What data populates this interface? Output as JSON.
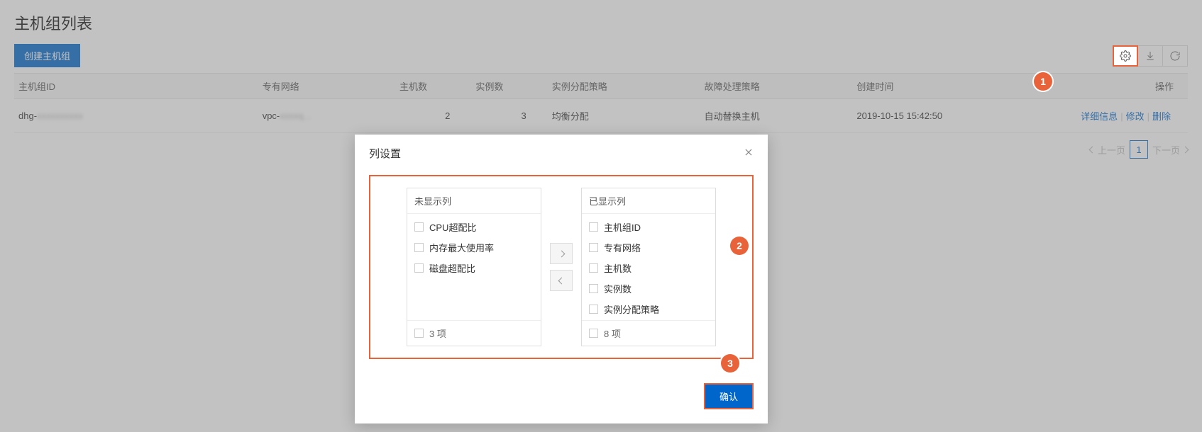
{
  "page_title": "主机组列表",
  "toolbar": {
    "create_button": "创建主机组"
  },
  "icons": {
    "settings": "gear-icon",
    "download": "download-icon",
    "refresh": "refresh-icon"
  },
  "columns": [
    "主机组ID",
    "专有网络",
    "主机数",
    "实例数",
    "实例分配策略",
    "故障处理策略",
    "创建时间",
    "操作"
  ],
  "row": {
    "host_group_id_prefix": "dhg-",
    "host_group_id_masked": "xxxxxxxxxx",
    "vpc_prefix": "vpc-",
    "vpc_masked": "xxxxq...",
    "host_count": "2",
    "instance_count": "3",
    "alloc_policy": "均衡分配",
    "fault_policy": "自动替换主机",
    "created_at": "2019-10-15 15:42:50",
    "actions": {
      "detail": "详细信息",
      "edit": "修改",
      "delete": "删除"
    }
  },
  "pagination": {
    "prev": "上一页",
    "page": "1",
    "next": "下一页"
  },
  "modal": {
    "title": "列设置",
    "left_header": "未显示列",
    "right_header": "已显示列",
    "left_items": [
      "CPU超配比",
      "内存最大使用率",
      "磁盘超配比"
    ],
    "right_items": [
      "主机组ID",
      "专有网络",
      "主机数",
      "实例数",
      "实例分配策略"
    ],
    "left_footer": "3 项",
    "right_footer": "8 项",
    "ok": "确认"
  },
  "annotations": {
    "a1": "1",
    "a2": "2",
    "a3": "3"
  }
}
